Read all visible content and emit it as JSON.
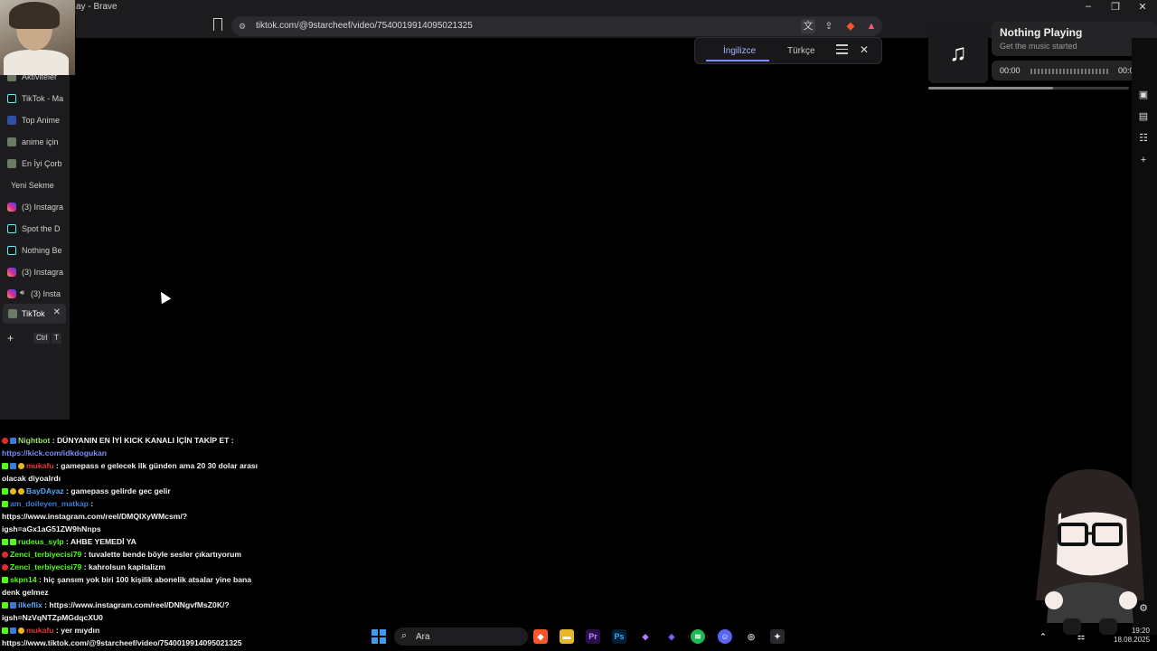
{
  "window": {
    "title": "ay - Brave"
  },
  "address_bar": {
    "url": "tiktok.com/@9starcheef/video/7540019914095021325"
  },
  "translate_popup": {
    "source_lang": "İngilizce",
    "target_lang": "Türkçe"
  },
  "sidebar": {
    "tabs": [
      {
        "label": "Aktiviteler",
        "favicon": "gear-icon"
      },
      {
        "label": "TikTok - Ma",
        "favicon": "tiktok"
      },
      {
        "label": "Top Anime",
        "favicon": "mal"
      },
      {
        "label": "anime için",
        "favicon": "img"
      },
      {
        "label": "En İyi Çorb",
        "favicon": "img"
      },
      {
        "label": "Yeni Sekme",
        "favicon": "none"
      },
      {
        "label": "(3) Instagra",
        "favicon": "insta"
      },
      {
        "label": "Spot the D",
        "favicon": "tiktok"
      },
      {
        "label": "Nothing Be",
        "favicon": "tiktok"
      },
      {
        "label": "(3) Instagra",
        "favicon": "insta"
      },
      {
        "label": "(3) Insta",
        "favicon": "insta"
      }
    ],
    "active_tab": {
      "label": "TikTok"
    },
    "new_tab": {
      "key1": "Ctrl",
      "key2": "T"
    }
  },
  "music": {
    "title": "Nothing Playing",
    "subtitle": "Get the music started",
    "time_current": "00:00",
    "time_total": "00:00",
    "progress": 0.62
  },
  "chat": [
    {
      "user": "Nightbot",
      "user_color": "#9ee36b",
      "text": "DÜNYANIN EN İYİ KICK KANALI İÇİN TAKİP ET :",
      "badges": [
        "red",
        "blue"
      ]
    },
    {
      "user": "",
      "user_color": "",
      "text": "https://kick.com/idkdogukan",
      "link": true,
      "badges": []
    },
    {
      "user": "mukafu",
      "user_color": "#e03a3a",
      "text": "gamepass e gelecek ilk günden ama 20 30 dolar arası",
      "badges": [
        "green",
        "blue",
        "gold"
      ]
    },
    {
      "user": "",
      "user_color": "",
      "text": "olacak diyoalrdı",
      "badges": []
    },
    {
      "user": "BayDAyaz",
      "user_color": "#5aa7ff",
      "text": "gamepass gelirde gec gelir",
      "badges": [
        "green",
        "gold",
        "gold"
      ]
    },
    {
      "user": "am_doileyen_matkap",
      "user_color": "#3a7bd5",
      "text": "",
      "badges": [
        "green"
      ]
    },
    {
      "user": "",
      "user_color": "",
      "text": "https://www.instagram.com/reel/DMQIXyWMcsm/?",
      "badges": []
    },
    {
      "user": "",
      "user_color": "",
      "text": "igsh=aGx1aG51ZW9hNnps",
      "badges": []
    },
    {
      "user": "rudeus_sylp",
      "user_color": "#53fc18",
      "text": "AHBE YEMEDİ YA",
      "badges": [
        "green",
        "green"
      ]
    },
    {
      "user": "Zenci_terbiyecisi79",
      "user_color": "#53fc18",
      "text": "tuvalette bende böyle sesler çıkartıyorum",
      "badges": [
        "red"
      ]
    },
    {
      "user": "Zenci_terbiyecisi79",
      "user_color": "#53fc18",
      "text": "kahrolsun kapitalizm",
      "badges": [
        "red"
      ]
    },
    {
      "user": "skpn14",
      "user_color": "#53fc18",
      "text": "hiç şansım yok biri 100 kişilik abonelik atsalar yine bana",
      "badges": [
        "green"
      ]
    },
    {
      "user": "",
      "user_color": "",
      "text": "denk gelmez",
      "badges": []
    },
    {
      "user": "ilkeflix",
      "user_color": "#5aa7ff",
      "text": "https://www.instagram.com/reel/DNNgvfMsZ0K/?",
      "badges": [
        "green",
        "blue"
      ]
    },
    {
      "user": "",
      "user_color": "",
      "text": "igsh=NzVqNTZpMGdqcXU0",
      "badges": []
    },
    {
      "user": "mukafu",
      "user_color": "#e03a3a",
      "text": "yer mıydın",
      "badges": [
        "green",
        "blue",
        "gold"
      ]
    },
    {
      "user": "",
      "user_color": "",
      "text": "https://www.tiktok.com/@9starcheef/video/7540019914095021325",
      "badges": []
    }
  ],
  "taskbar": {
    "search_placeholder": "Ara",
    "time": "19:20",
    "date": "18.08.2025"
  },
  "colors": {
    "accent": "#7d8cff",
    "kick_green": "#53fc18",
    "brave": "#fb542b"
  }
}
